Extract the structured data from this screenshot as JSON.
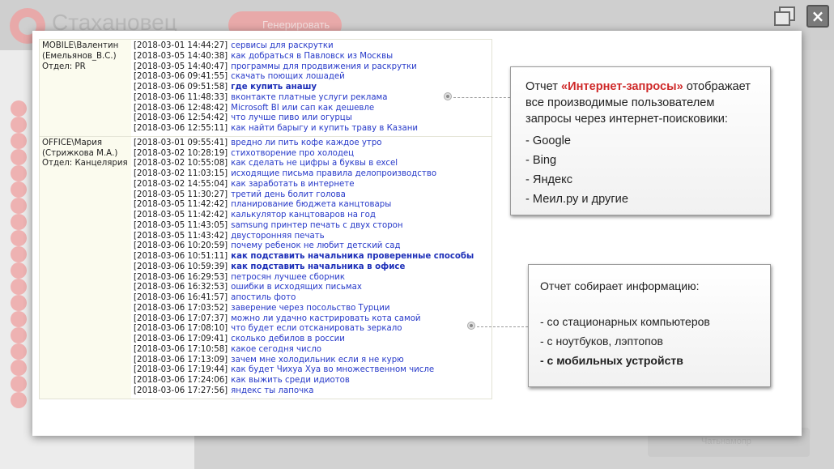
{
  "app": {
    "title": "Стахановец",
    "generate_button": "Генерировать",
    "bottom_item": "Чатьнамопр"
  },
  "colors": {
    "accent": "#cf2a2a",
    "link": "#2639c9",
    "user_cell_bg": "#fbfbee"
  },
  "window_controls": {
    "restore_icon": "restore-icon",
    "close_icon": "×"
  },
  "log": [
    {
      "user": "MOBILE\\Валентин",
      "full_name": "(Емельянов_В.С.)",
      "department": "Отдел: PR",
      "rows": [
        {
          "ts": "[2018-03-01 14:44:27]",
          "query": "сервисы для раскрутки",
          "bold": false
        },
        {
          "ts": "[2018-03-05 14:40:38]",
          "query": "как добраться в Павловск из Москвы",
          "bold": false
        },
        {
          "ts": "[2018-03-05 14:40:47]",
          "query": "программы для продвижения и раскрутки",
          "bold": false
        },
        {
          "ts": "[2018-03-06 09:41:55]",
          "query": "скачать поющих лошадей",
          "bold": false
        },
        {
          "ts": "[2018-03-06 09:51:58]",
          "query": "где купить анашу",
          "bold": true
        },
        {
          "ts": "[2018-03-06 11:48:33]",
          "query": "вконтакте платные услуги реклама",
          "bold": false
        },
        {
          "ts": "[2018-03-06 12:48:42]",
          "query": "Microsoft BI или сап как дешевле",
          "bold": false
        },
        {
          "ts": "[2018-03-06 12:54:42]",
          "query": "что лучше пиво или огурцы",
          "bold": false
        },
        {
          "ts": "[2018-03-06 12:55:11]",
          "query": "как найти барыгу и купить траву в Казани",
          "bold": false
        }
      ]
    },
    {
      "user": "OFFICE\\Мария",
      "full_name": "(Стрижкова М.А.)",
      "department": "Отдел: Канцелярия",
      "rows": [
        {
          "ts": "[2018-03-01 09:55:41]",
          "query": "вредно ли пить кофе каждое утро",
          "bold": false
        },
        {
          "ts": "[2018-03-02 10:28:19]",
          "query": "стихотворение про холодец",
          "bold": false
        },
        {
          "ts": "[2018-03-02 10:55:08]",
          "query": "как сделать не цифры а буквы в excel",
          "bold": false
        },
        {
          "ts": "[2018-03-02 11:03:15]",
          "query": "исходящие письма правила делопроизводство",
          "bold": false
        },
        {
          "ts": "[2018-03-02 14:55:04]",
          "query": "как заработать в интернете",
          "bold": false
        },
        {
          "ts": "[2018-03-05 11:30:27]",
          "query": "третий день болит голова",
          "bold": false
        },
        {
          "ts": "[2018-03-05 11:42:42]",
          "query": "планирование бюджета канцтовары",
          "bold": false
        },
        {
          "ts": "[2018-03-05 11:42:42]",
          "query": "калькулятор канцтоваров на год",
          "bold": false
        },
        {
          "ts": "[2018-03-05 11:43:05]",
          "query": "samsung принтер печать с двух сторон",
          "bold": false
        },
        {
          "ts": "[2018-03-05 11:43:42]",
          "query": "двусторонняя печать",
          "bold": false
        },
        {
          "ts": "[2018-03-06 10:20:59]",
          "query": "почему ребенок не любит детский сад",
          "bold": false
        },
        {
          "ts": "[2018-03-06 10:51:11]",
          "query": "как подставить начальника проверенные способы",
          "bold": true
        },
        {
          "ts": "[2018-03-06 10:59:39]",
          "query": "как подставить начальника в офисе",
          "bold": true
        },
        {
          "ts": "[2018-03-06 16:29:53]",
          "query": "петросян лучшее сборник",
          "bold": false
        },
        {
          "ts": "[2018-03-06 16:32:53]",
          "query": "ошибки в исходящих письмах",
          "bold": false
        },
        {
          "ts": "[2018-03-06 16:41:57]",
          "query": "апостиль фото",
          "bold": false
        },
        {
          "ts": "[2018-03-06 17:03:52]",
          "query": "заверение через посольство Турции",
          "bold": false
        },
        {
          "ts": "[2018-03-06 17:07:37]",
          "query": "можно ли удачно кастрировать кота самой",
          "bold": false
        },
        {
          "ts": "[2018-03-06 17:08:10]",
          "query": "что будет если отсканировать зеркало",
          "bold": false
        },
        {
          "ts": "[2018-03-06 17:09:41]",
          "query": "сколько дебилов в россии",
          "bold": false
        },
        {
          "ts": "[2018-03-06 17:10:58]",
          "query": "какое сегодня число",
          "bold": false
        },
        {
          "ts": "[2018-03-06 17:13:09]",
          "query": "зачем мне холодильник если я не курю",
          "bold": false
        },
        {
          "ts": "[2018-03-06 17:19:44]",
          "query": "как будет Чихуа Хуа во множественном числе",
          "bold": false
        },
        {
          "ts": "[2018-03-06 17:24:06]",
          "query": "как выжить среди идиотов",
          "bold": false
        },
        {
          "ts": "[2018-03-06 17:27:56]",
          "query": "яндекс ты лапочка",
          "bold": false
        }
      ]
    }
  ],
  "callout_1": {
    "prefix": "Отчет ",
    "highlight": "«Интернет-запросы»",
    "suffix": " отображает все производимые пользователем запросы через интернет-поисковики:",
    "items": [
      "- Google",
      "- Bing",
      "- Яндекс",
      "- Меил.ру и другие"
    ]
  },
  "callout_2": {
    "intro": "Отчет собирает информацию:",
    "items": [
      {
        "text": "- со стационарных компьютеров",
        "bold": false
      },
      {
        "text": "- с ноутбуков, лэптопов",
        "bold": false
      },
      {
        "text": "- с мобильных устройств",
        "bold": true
      }
    ]
  }
}
